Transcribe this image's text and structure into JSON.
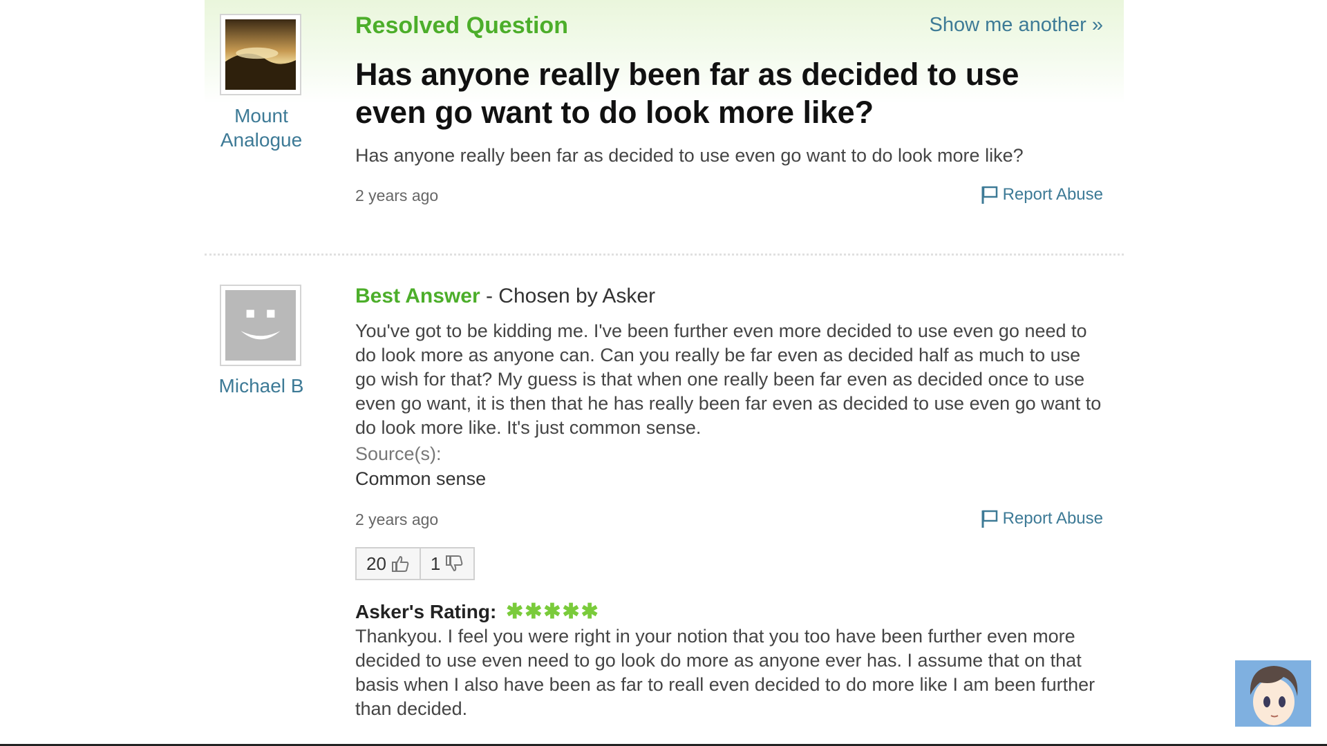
{
  "question": {
    "status": "Resolved Question",
    "show_another": "Show me another »",
    "title": "Has anyone really been far as decided to use even go want to do look more like?",
    "body": "Has anyone really been far as decided to use even go want to do look more like?",
    "time": "2 years ago",
    "report": "Report Abuse",
    "asker": "Mount Analogue"
  },
  "answer": {
    "label": "Best Answer",
    "chosen": "- Chosen by Asker",
    "author": "Michael B",
    "text": "You've got to be kidding me. I've been further even more decided to use even go need to do look more as anyone can. Can you really be far even as decided half as much to use go wish for that? My guess is that when one really been far even as decided once to use even go want, it is then that he has really been far even as decided to use even go want to do look more like. It's just common sense.",
    "sources_label": "Source(s):",
    "sources_value": "Common sense",
    "time": "2 years ago",
    "report": "Report Abuse",
    "thumbs_up": "20",
    "thumbs_down": "1",
    "rating_label": "Asker's Rating:",
    "rating_stars": 5,
    "rating_comment": "Thankyou. I feel you were right in your notion that you too have been further even more decided to use even need to go look do more as anyone ever has. I assume that on that basis when I also have been as far to reall even decided to do more like I am been further than decided."
  },
  "colors": {
    "green": "#4cae2a",
    "link_blue": "#3d7a96",
    "star_green": "#7acb3b"
  }
}
